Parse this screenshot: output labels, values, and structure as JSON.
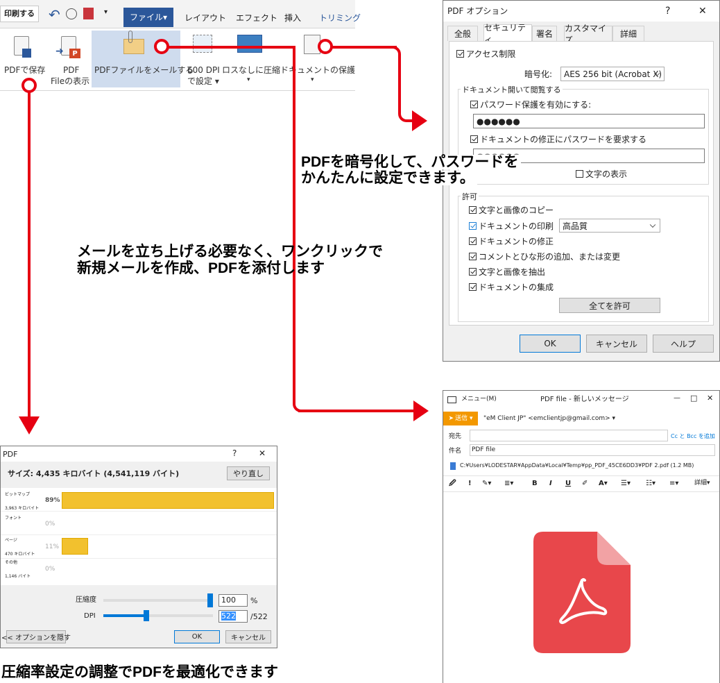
{
  "ribbon": {
    "print_button": "印刷する",
    "tabs": [
      "ファイル▾",
      "レイアウト",
      "エフェクト",
      "挿入",
      "トリミング"
    ],
    "buttons": [
      {
        "line1": "PDFで保存",
        "line2": ""
      },
      {
        "line1": "PDF",
        "line2": "Fileの表示"
      },
      {
        "line1": "PDFファイルをメールする",
        "line2": ""
      },
      {
        "line1": "600 DPI",
        "line2": "で設定 ▾"
      },
      {
        "line1": "ロスなしに圧縮",
        "line2": "▾"
      },
      {
        "line1": "ドキュメントの保護",
        "line2": "▾"
      }
    ]
  },
  "pdf_options": {
    "title": "PDF オプション",
    "help": "?",
    "close": "✕",
    "tabs": [
      "全般",
      "セキュリティ",
      "署名",
      "カスタマイズ",
      "詳細"
    ],
    "access_restriction": "アクセス制限",
    "encryption_label": "暗号化:",
    "encryption_value": "AES 256 bit (Acrobat X)",
    "open_group_label": "ドキュメント開いて閲覧する",
    "enable_password": "パスワード保護を有効にする:",
    "password_value": "●●●●●●",
    "modify_password": "ドキュメントの修正にパスワードを要求する",
    "modify_password_value": "●●●●●●",
    "show_text": "文字の表示",
    "permissions_label": "許可",
    "permissions": [
      "文字と画像のコピー",
      "ドキュメントの印刷",
      "ドキュメントの修正",
      "コメントとひな形の追加、または変更",
      "文字と画像を抽出",
      "ドキュメントの集成"
    ],
    "print_quality": "高品質",
    "allow_all": "全てを許可",
    "ok": "OK",
    "cancel": "キャンセル",
    "help_button": "ヘルプ"
  },
  "annotations": {
    "encrypt_line1": "PDFを暗号化して、パスワードを",
    "encrypt_line2": "かんたんに設定できます。",
    "mail_line1": "メールを立ち上げる必要なく、ワンクリックで",
    "mail_line2": "新規メールを作成、PDFを添付します",
    "compress": "圧縮率設定の調整でPDFを最適化できます"
  },
  "compress_dialog": {
    "title": "PDF",
    "help": "?",
    "close": "✕",
    "size_text": "サイズ: 4,435 キロバイト (4,541,119 バイト)",
    "redo_button": "やり直し",
    "rows": [
      {
        "name": "ビットマップ",
        "size": "3,963 キロバイト",
        "percent": "89%",
        "fraction": 0.89
      },
      {
        "name": "フォント",
        "size": "",
        "percent": "0%",
        "fraction": 0
      },
      {
        "name": "ページ",
        "size": "470 キロバイト",
        "percent": "11%",
        "fraction": 0.11
      },
      {
        "name": "その他",
        "size": "1,146 バイト",
        "percent": "0%",
        "fraction": 0
      }
    ],
    "compression_label": "圧縮度",
    "compression_value": "100",
    "compression_unit": "%",
    "dpi_label": "DPI",
    "dpi_value": "522",
    "dpi_max": "/522",
    "hide_options": "<< オプションを隠す",
    "ok": "OK",
    "cancel": "キャンセル"
  },
  "email": {
    "menu": "メニュー(M)",
    "title": "PDF file - 新しいメッセージ",
    "minimize": "—",
    "maximize": "□",
    "close": "✕",
    "send": "送信 ▾",
    "from": "\"eM Client JP\" <emclientjp@gmail.com> ▾",
    "to_label": "宛先",
    "cc_bcc": "Cc と Bcc を追加",
    "subject_label": "件名",
    "subject_value": "PDF file",
    "attachment": "C:¥Users¥LODESTAR¥AppData¥Local¥Temp¥pp_PDF_45CE6DD3¥PDF 2.pdf (1.2 MB)",
    "toolbar": [
      "🖉",
      "!",
      "✎▾",
      "≣▾",
      "B",
      "I",
      "U",
      "✐",
      "A▾",
      "☰▾",
      "☷▾",
      "≡▾",
      "詳細▾"
    ]
  },
  "colors": {
    "accent_red": "#e60012",
    "ribbon_blue": "#2b579a",
    "send_orange": "#f39800",
    "pdf_red": "#e8474b",
    "bar_yellow": "#f2c12e"
  }
}
